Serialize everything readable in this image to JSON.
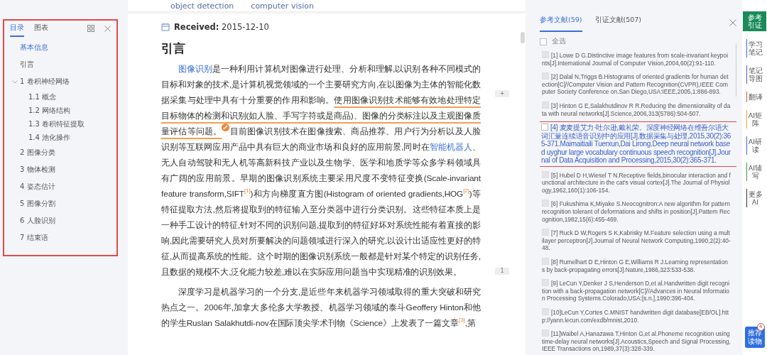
{
  "sidebar": {
    "tabs": [
      {
        "label": "目录",
        "selected": true
      },
      {
        "label": "图表",
        "selected": false
      }
    ],
    "highlighted": true,
    "items": [
      {
        "label": "基本信息",
        "selected": true
      },
      {
        "label": "引言",
        "selected": false
      },
      {
        "label": "1 卷积神经网络",
        "selected": false,
        "expanded": true,
        "children": [
          {
            "label": "1.1 概念",
            "selected": false
          },
          {
            "label": "1.2 网络结构",
            "selected": false
          },
          {
            "label": "1.3 卷积特征提取",
            "selected": false
          },
          {
            "label": "1.4 池化操作",
            "selected": false
          }
        ]
      },
      {
        "label": "2 图像分类",
        "selected": false
      },
      {
        "label": "3 物体检测",
        "selected": false
      },
      {
        "label": "4 姿态估计",
        "selected": false
      },
      {
        "label": "5 图像分割",
        "selected": false
      },
      {
        "label": "6 人脸识别",
        "selected": false
      },
      {
        "label": "7 结束语",
        "selected": false
      }
    ]
  },
  "article": {
    "keywords": [
      "object detection",
      "computer vision"
    ],
    "received_label": "Received:",
    "received_date": "2015-12-10",
    "heading": "引言",
    "paragraphs": [
      [
        {
          "kind": "link",
          "text": "图像识别"
        },
        {
          "kind": "plain",
          "text": "是一种利用计算机对图像进行处理、分析和理解,以识别各种不同模式的目标和对象的技术,是计算机视觉领域的一个主要研究方向,在以图像为主体的智能化数据采集与处理中具有十分重要的作用和影响。"
        },
        {
          "kind": "underline",
          "text": "使用图像识别技术能够有效地处理特定目标物体的检测和识别(如人脸、手写字符或是商品)、图像的分类标注以及主观图像质量评估等问题。"
        },
        {
          "kind": "note"
        },
        {
          "kind": "plain",
          "text": "目前图像识别技术在图像搜索、商品推荐、用户行为分析以及人脸识别等互联网应用产品中具有巨大的商业市场和良好的应用前景,同时在"
        },
        {
          "kind": "link",
          "text": "智能机器人"
        },
        {
          "kind": "plain",
          "text": "、无人自动驾驶和无人机等高新科技产业以及生物学、医学和地质学等众多学科领域具有广阔的应用前景。早期的图像识别系统主要采用尺度不变特征变换(Scale-invariant feature transform,SIFT"
        },
        {
          "kind": "cite",
          "text": "[1]"
        },
        {
          "kind": "plain",
          "text": ")和方向梯度直方图(Histogram of oriented gradients,HOG"
        },
        {
          "kind": "cite",
          "text": "[2]"
        },
        {
          "kind": "plain",
          "text": ")等特征提取方法,然后将提取到的特征输入至分类器中进行分类识别。这些特征本质上是一种手工设计的特征,针对不同的识别问题,提取到的特征好坏对系统性能有着直接的影响,因此需要研究人员对所要解决的问题领域进行深入的研究,以设计出适应性更好的特征,从而提高系统的性能。这个时期的图像识别系统一般都是针对某个特定的识别任务,且数据的规模不大,泛化能力较差,难以在实际应用问题当中实现精准的识别效果。"
        }
      ],
      [
        {
          "kind": "plain",
          "text": "深度学习是机器学习的一个分支,是近些年来机器学习领域取得的重大突破和研究热点之一。2006年,加拿大多伦多大学教授、机器学习领域的泰斗Geoffery Hinton和他的学生Ruslan Salakhutdi-nov在国际顶尖学术刊物《Science》上发表了一篇文章"
        },
        {
          "kind": "cite",
          "text": "[3]"
        },
        {
          "kind": "plain",
          "text": ",第"
        }
      ]
    ],
    "gutter": [
      {
        "label": "+"
      },
      {
        "label": "1"
      }
    ]
  },
  "references": {
    "tabs": [
      {
        "label": "参考文献(59)",
        "selected": true
      },
      {
        "label": "引证文献(507)",
        "selected": false
      }
    ],
    "select_all": {
      "label": "全选",
      "checked": false
    },
    "items": [
      {
        "text": "[1] Lowe D G.Distinctive image features from scale-invariant keypoints[J].International Journal of Computer Vision,2004,60(2):91-110.",
        "checked": false,
        "highlighted": false
      },
      {
        "text": "[2] Dalal N,Triggs B.Histograms of oriented gradients for human detection[C]//Computer Vision and Pattern Recognition(CVPR),IEEE Computer Society Conference on.San Diego,USA:IEEE,2005,1:886-893.",
        "checked": false,
        "highlighted": false
      },
      {
        "text": "[3] Hinton G E,Salakhutdinov R R.Reducing the dimensionality of data with neural networks[J].Science,2006,313(5786):504-507.",
        "checked": false,
        "highlighted": false
      },
      {
        "text": "[4] 麦麦提艾力·吐尔逊,戴礼荣。深度神经网络在维吾尔语大词汇量连续语音识别中的应用[J].数据采集与处理,2015,30(2):365-371.Maimaitiaili Tuerxun,Dai Lirong.Deep neural network based uyghur large vocabulary continuous speech recognition[J].Journal of Data Acquisition and Processing,2015,30(2):365-371.",
        "checked": false,
        "highlighted": true
      },
      {
        "text": "[5] Hubel D H,Wiesel T N.Receptive fields,binocular interaction and functional architecture in the cat's visual cortex[J].The Journal of Physiology,1962,160(1):106-154.",
        "checked": false,
        "highlighted": false
      },
      {
        "text": "[6] Fukushima K,Miyake S.Neocognitron:A new algorithm for pattern recognition tolerant of deformations and shifts in position[J].Pattern Recognition,1982,15(6):455-469.",
        "checked": false,
        "highlighted": false
      },
      {
        "text": "[7] Ruck D W,Rogers S K,Kabrisky M.Feature selection using a multilayer perceptron[J].Journal of Neural Network Computing,1990,2(2):40-48.",
        "checked": false,
        "highlighted": false
      },
      {
        "text": "[8] Rumelhart D E,Hinton G E,Williams R J.Learning representations by back-propagating errors[J].Nature,1986,323:533-538.",
        "checked": false,
        "highlighted": false
      },
      {
        "text": "[9] LeCun Y,Denker J S,Henderson D,et al.Handwritten digit recognition with a back-propagation network[C]//Advances in Neural Information Processing Systems.Colorado,USA:[s.n.],1990:396-404.",
        "checked": false,
        "highlighted": false
      },
      {
        "text": "[10]LeCun Y,Cortes C.MNIST handwritten digit database[EB/OL].http://yann.lecun.com/exdb/mnist,2010.",
        "checked": false,
        "highlighted": false
      },
      {
        "text": "[11]Waibel A,Hanazawa T,Hinton G,et al.Phoneme recognition using time-delay neural networks[J].Acoustics,Speech and Signal Processing,IEEE Transactions on,1989,37(3):328-339.",
        "checked": false,
        "highlighted": false
      }
    ]
  },
  "toolstrip": {
    "items": [
      {
        "label": "参考引证",
        "selected": true,
        "color": "#1a8a5a"
      },
      {
        "label": "学习笔记",
        "selected": false,
        "color": "#3b6fd9"
      },
      {
        "label": "笔记导图",
        "selected": false,
        "color": "#5a5ad0"
      },
      {
        "label": "翻译",
        "selected": false,
        "color": "#e05050"
      },
      {
        "label": "AI矩阵",
        "selected": false,
        "color": "#f0a050"
      },
      {
        "label": "AI研读",
        "selected": false,
        "color": "#3b6fd9"
      },
      {
        "label": "AI辅写",
        "selected": false,
        "color": "#3aa040"
      },
      {
        "label": "更多AI",
        "selected": false,
        "color": "#333333"
      }
    ],
    "recommend": {
      "label": "推荐读物",
      "badge": "4"
    }
  }
}
